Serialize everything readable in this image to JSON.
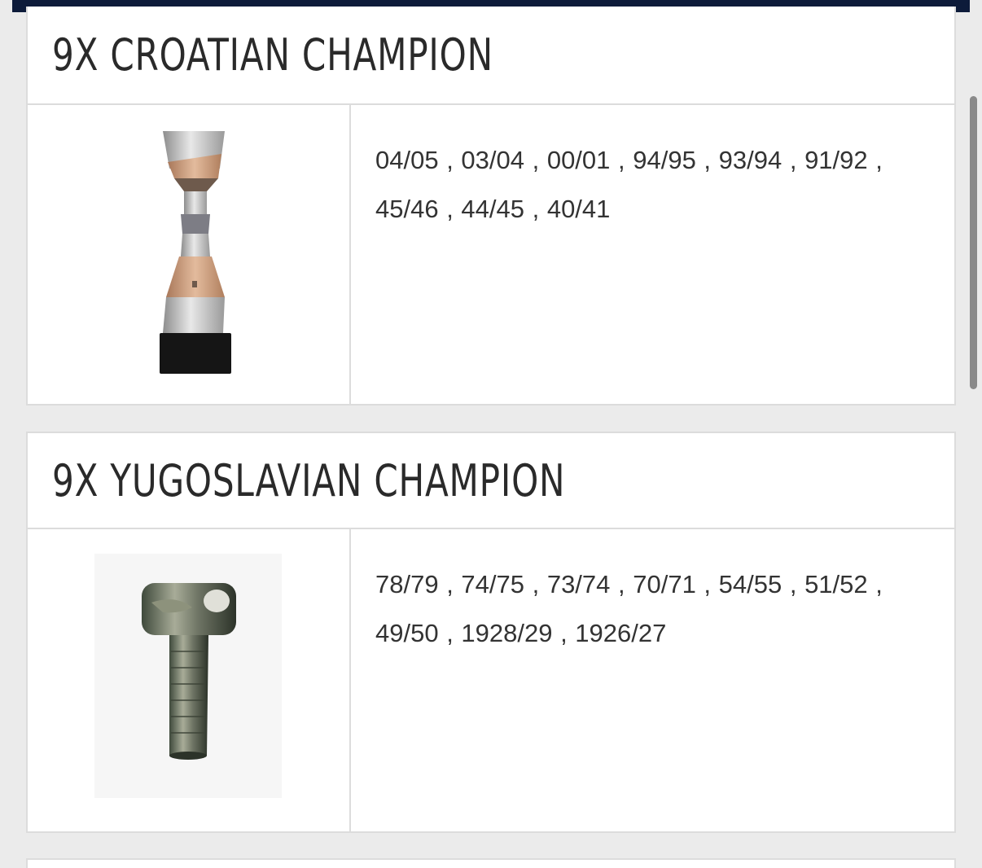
{
  "sections": [
    {
      "title": "9X CROATIAN CHAMPION",
      "trophy_icon": "croatian-cup-trophy",
      "seasons": "04/05 , 03/04 , 00/01 , 94/95 , 93/94 , 91/92 , 45/46 , 44/45 , 40/41"
    },
    {
      "title": "9X YUGOSLAVIAN CHAMPION",
      "trophy_icon": "yugoslavian-trophy",
      "seasons": "78/79 , 74/75 , 73/74 , 70/71 , 54/55 , 51/52 , 49/50 , 1928/29 , 1926/27"
    }
  ],
  "colors": {
    "top_bar": "#0d1b3a",
    "background": "#ebebeb",
    "card": "#ffffff",
    "border": "#dcdcdc",
    "text": "#333333"
  }
}
